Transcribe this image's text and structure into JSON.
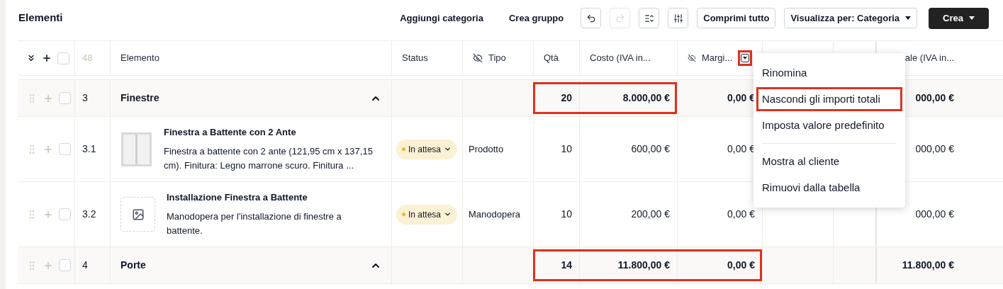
{
  "title": "Elementi",
  "toolbar": {
    "text_buttons": [
      "Aggiungi categoria",
      "Crea gruppo"
    ],
    "icon_buttons": [
      {
        "kind": "undo",
        "disabled": false
      },
      {
        "kind": "redo",
        "disabled": true
      },
      {
        "kind": "row-height",
        "disabled": false
      },
      {
        "kind": "sliders",
        "disabled": false
      }
    ],
    "collapse": "Comprimi tutto",
    "view_select": "Visualizza per: Categoria",
    "create": "Crea"
  },
  "table": {
    "count": "48",
    "select_all_checked": false,
    "columns": [
      {
        "label": "Elemento",
        "hidden": false
      },
      {
        "label": "Status",
        "hidden": false
      },
      {
        "label": "Tipo",
        "hidden": true
      },
      {
        "label": "Qtà",
        "hidden": false
      },
      {
        "label": "Costo (IVA in...",
        "hidden": false
      },
      {
        "label": "Margi...",
        "hidden": true,
        "menu_button": true,
        "highlighted": true
      },
      {},
      {},
      {
        "label": "ale (IVA in...",
        "hidden": false
      }
    ],
    "rows": [
      {
        "kind": "group",
        "checked": false,
        "num": "3",
        "name": "Finestre",
        "expanded": true,
        "qty": {
          "text": "20",
          "highlighted": true
        },
        "cost": {
          "text": "8.000,00 €",
          "highlighted": true
        },
        "margin": {
          "text": "0,00 €",
          "highlighted": false
        },
        "total": {
          "text": "000,00 €",
          "highlighted": false
        }
      },
      {
        "kind": "item",
        "checked": false,
        "num": "3.1",
        "title": "Finestra a Battente con 2 Ante",
        "description": "Finestra a battente con 2 ante (121,95 cm x 137,15 cm). Finitura: Legno marrone scuro. Finitura ...",
        "status": {
          "label": "In attesa",
          "color": "#e8b931"
        },
        "type": "Prodotto",
        "qty": {
          "text": "10",
          "highlighted": false
        },
        "cost": {
          "text": "600,00 €",
          "highlighted": false
        },
        "margin": {
          "text": "0,00 €",
          "highlighted": false
        },
        "total": {
          "text": "000,00 €",
          "highlighted": false
        }
      },
      {
        "kind": "item",
        "checked": false,
        "num": "3.2",
        "title": "Installazione Finestra a Battente",
        "description": "Manodopera per l'installazione di finestre a battente.",
        "thumbnail": {
          "kind": "placeholder"
        },
        "status": {
          "label": "In attesa",
          "color": "#e8b931"
        },
        "type": "Manodopera",
        "qty": {
          "text": "10",
          "highlighted": false
        },
        "cost": {
          "text": "200,00 €",
          "highlighted": false
        },
        "margin": {
          "text": "0,00 €",
          "highlighted": false
        },
        "total": {
          "text": "000,00 €",
          "highlighted": false
        }
      },
      {
        "kind": "group",
        "checked": false,
        "num": "4",
        "name": "Porte",
        "expanded": true,
        "qty": {
          "text": "14",
          "highlighted": true
        },
        "cost": {
          "text": "11.800,00 €",
          "highlighted": true
        },
        "margin": {
          "text": "0,00 €",
          "highlighted": true
        },
        "total": {
          "text": "11.800,00 €",
          "highlighted": false
        }
      }
    ]
  },
  "column_menu": {
    "items": [
      {
        "label": "Rinomina",
        "highlighted": false,
        "divider_after": false
      },
      {
        "label": "Nascondi gli importi totali",
        "highlighted": true,
        "divider_after": false
      },
      {
        "label": "Imposta valore predefinito",
        "highlighted": false,
        "divider_after": true
      },
      {
        "label": "Mostra al cliente",
        "highlighted": false,
        "divider_after": false
      },
      {
        "label": "Rimuovi dalla tabella",
        "highlighted": false,
        "divider_after": false
      }
    ]
  }
}
